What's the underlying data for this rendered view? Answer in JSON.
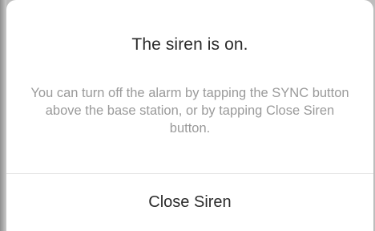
{
  "dialog": {
    "title": "The siren is on.",
    "message": "You can turn off the alarm by tapping the SYNC button above the base station, or by tapping Close Siren button.",
    "action_label": "Close Siren"
  }
}
